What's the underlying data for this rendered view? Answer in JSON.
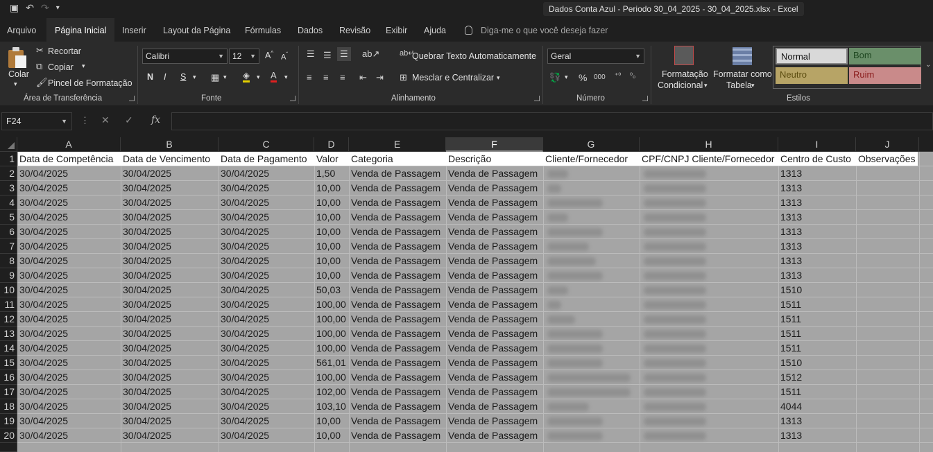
{
  "window": {
    "title": "Dados Conta Azul - Periodo 30_04_2025 - 30_04_2025.xlsx  -  Excel"
  },
  "tabs": [
    "Arquivo",
    "Página Inicial",
    "Inserir",
    "Layout da Página",
    "Fórmulas",
    "Dados",
    "Revisão",
    "Exibir",
    "Ajuda"
  ],
  "tell_me": "Diga-me o que você deseja fazer",
  "ribbon": {
    "clipboard": {
      "paste": "Colar",
      "cut": "Recortar",
      "copy": "Copiar",
      "format_painter": "Pincel de Formatação",
      "label": "Área de Transferência"
    },
    "font": {
      "name": "Calibri",
      "size": "12",
      "bold": "N",
      "italic": "I",
      "underline": "S",
      "label": "Fonte"
    },
    "alignment": {
      "wrap": "Quebrar Texto Automaticamente",
      "merge": "Mesclar e Centralizar",
      "label": "Alinhamento"
    },
    "number": {
      "format": "Geral",
      "label": "Número"
    },
    "styles": {
      "cond_format_1": "Formatação",
      "cond_format_2": "Condicional",
      "table_1": "Formatar como",
      "table_2": "Tabela",
      "normal": "Normal",
      "bom": "Bom",
      "neutro": "Neutro",
      "ruim": "Ruim",
      "label": "Estilos"
    }
  },
  "formula_bar": {
    "name_box": "F24",
    "fx": "fx",
    "value": ""
  },
  "columns": [
    "A",
    "B",
    "C",
    "D",
    "E",
    "F",
    "G",
    "H",
    "I",
    "J"
  ],
  "selected_column": "F",
  "header_row": [
    "Data de Competência",
    "Data de Vencimento",
    "Data de Pagamento",
    "Valor",
    "Categoria",
    "Descrição",
    "Cliente/Fornecedor",
    "CPF/CNPJ Cliente/Fornecedor",
    "Centro de Custo",
    "Observações"
  ],
  "rows": [
    {
      "n": "2",
      "a": "30/04/2025",
      "b": "30/04/2025",
      "c": "30/04/2025",
      "d": "1,50",
      "e": "Venda de Passagem",
      "f": "Venda de Passagem",
      "i": "1313"
    },
    {
      "n": "3",
      "a": "30/04/2025",
      "b": "30/04/2025",
      "c": "30/04/2025",
      "d": "10,00",
      "e": "Venda de Passagem",
      "f": "Venda de Passagem",
      "i": "1313"
    },
    {
      "n": "4",
      "a": "30/04/2025",
      "b": "30/04/2025",
      "c": "30/04/2025",
      "d": "10,00",
      "e": "Venda de Passagem",
      "f": "Venda de Passagem",
      "i": "1313"
    },
    {
      "n": "5",
      "a": "30/04/2025",
      "b": "30/04/2025",
      "c": "30/04/2025",
      "d": "10,00",
      "e": "Venda de Passagem",
      "f": "Venda de Passagem",
      "i": "1313"
    },
    {
      "n": "6",
      "a": "30/04/2025",
      "b": "30/04/2025",
      "c": "30/04/2025",
      "d": "10,00",
      "e": "Venda de Passagem",
      "f": "Venda de Passagem",
      "i": "1313"
    },
    {
      "n": "7",
      "a": "30/04/2025",
      "b": "30/04/2025",
      "c": "30/04/2025",
      "d": "10,00",
      "e": "Venda de Passagem",
      "f": "Venda de Passagem",
      "i": "1313"
    },
    {
      "n": "8",
      "a": "30/04/2025",
      "b": "30/04/2025",
      "c": "30/04/2025",
      "d": "10,00",
      "e": "Venda de Passagem",
      "f": "Venda de Passagem",
      "i": "1313"
    },
    {
      "n": "9",
      "a": "30/04/2025",
      "b": "30/04/2025",
      "c": "30/04/2025",
      "d": "10,00",
      "e": "Venda de Passagem",
      "f": "Venda de Passagem",
      "i": "1313"
    },
    {
      "n": "10",
      "a": "30/04/2025",
      "b": "30/04/2025",
      "c": "30/04/2025",
      "d": "50,03",
      "e": "Venda de Passagem",
      "f": "Venda de Passagem",
      "i": "1510"
    },
    {
      "n": "11",
      "a": "30/04/2025",
      "b": "30/04/2025",
      "c": "30/04/2025",
      "d": "100,00",
      "e": "Venda de Passagem",
      "f": "Venda de Passagem",
      "i": "1511"
    },
    {
      "n": "12",
      "a": "30/04/2025",
      "b": "30/04/2025",
      "c": "30/04/2025",
      "d": "100,00",
      "e": "Venda de Passagem",
      "f": "Venda de Passagem",
      "i": "1511"
    },
    {
      "n": "13",
      "a": "30/04/2025",
      "b": "30/04/2025",
      "c": "30/04/2025",
      "d": "100,00",
      "e": "Venda de Passagem",
      "f": "Venda de Passagem",
      "i": "1511"
    },
    {
      "n": "14",
      "a": "30/04/2025",
      "b": "30/04/2025",
      "c": "30/04/2025",
      "d": "100,00",
      "e": "Venda de Passagem",
      "f": "Venda de Passagem",
      "i": "1511"
    },
    {
      "n": "15",
      "a": "30/04/2025",
      "b": "30/04/2025",
      "c": "30/04/2025",
      "d": "561,01",
      "e": "Venda de Passagem",
      "f": "Venda de Passagem",
      "i": "1510"
    },
    {
      "n": "16",
      "a": "30/04/2025",
      "b": "30/04/2025",
      "c": "30/04/2025",
      "d": "100,00",
      "e": "Venda de Passagem",
      "f": "Venda de Passagem",
      "i": "1512"
    },
    {
      "n": "17",
      "a": "30/04/2025",
      "b": "30/04/2025",
      "c": "30/04/2025",
      "d": "102,00",
      "e": "Venda de Passagem",
      "f": "Venda de Passagem",
      "i": "1511"
    },
    {
      "n": "18",
      "a": "30/04/2025",
      "b": "30/04/2025",
      "c": "30/04/2025",
      "d": "103,10",
      "e": "Venda de Passagem",
      "f": "Venda de Passagem",
      "i": "4044"
    },
    {
      "n": "19",
      "a": "30/04/2025",
      "b": "30/04/2025",
      "c": "30/04/2025",
      "d": "10,00",
      "e": "Venda de Passagem",
      "f": "Venda de Passagem",
      "i": "1313"
    },
    {
      "n": "20",
      "a": "30/04/2025",
      "b": "30/04/2025",
      "c": "30/04/2025",
      "d": "10,00",
      "e": "Venda de Passagem",
      "f": "Venda de Passagem",
      "i": "1313"
    }
  ],
  "colors": {
    "bom_bg": "#6a8f6a",
    "neutro_bg": "#b7a466",
    "ruim_bg": "#c98a8a",
    "normal_bg": "#d9d9d9"
  }
}
